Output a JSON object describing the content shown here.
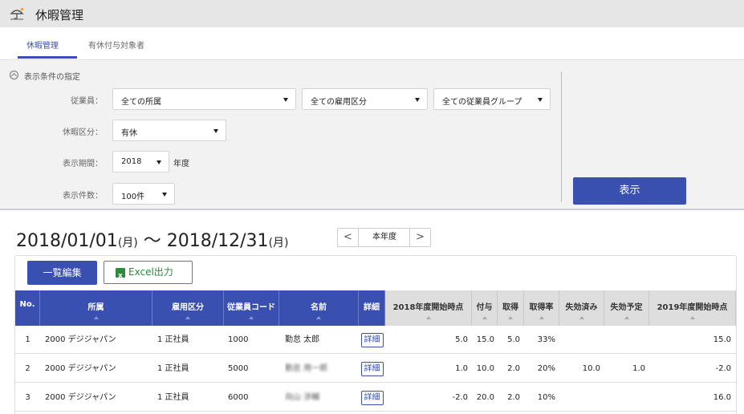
{
  "app": {
    "title": "休暇管理",
    "logo_icon": "umbrella-sun-icon"
  },
  "tabs": [
    {
      "label": "休暇管理",
      "active": true
    },
    {
      "label": "有休付与対象者",
      "active": false
    }
  ],
  "filter": {
    "header": "表示条件の指定",
    "employee_label": "従業員：",
    "department": "全ての所属",
    "employment_type": "全ての雇用区分",
    "employee_group": "全ての従業員グループ",
    "leave_type_label": "休暇区分：",
    "leave_type": "有休",
    "period_label": "表示期間：",
    "year": "2018",
    "year_unit": "年度",
    "count_label": "表示件数：",
    "count": "100件",
    "show_button": "表示"
  },
  "range": {
    "start": "2018/01/01",
    "start_dow": "(月)",
    "sep": " ～ ",
    "end": "2018/12/31",
    "end_dow": "(月)",
    "prev": "<",
    "current": "本年度",
    "next": ">"
  },
  "toolbar": {
    "edit_button": "一覧編集",
    "excel_button": "Excel出力"
  },
  "table": {
    "headers": [
      "No.",
      "所属",
      "雇用区分",
      "従業員コード",
      "名前",
      "詳細",
      "2018年度開始時点",
      "付与",
      "取得",
      "取得率",
      "失効済み",
      "失効予定",
      "2019年度開始時点"
    ],
    "rows": [
      {
        "no": "1",
        "dept": "2000 デジジャパン",
        "type": "1 正社員",
        "code": "1000",
        "name": "勤怠 太郎",
        "detail": "詳細",
        "start": "5.0",
        "grant": "15.0",
        "taken": "5.0",
        "rate": "33%",
        "expired": "",
        "expiring": "",
        "next": "15.0"
      },
      {
        "no": "2",
        "dept": "2000 デジジャパン",
        "type": "1 正社員",
        "code": "5000",
        "name": "勤怠 用一郎",
        "detail": "詳細",
        "start": "1.0",
        "grant": "10.0",
        "taken": "2.0",
        "rate": "20%",
        "expired": "10.0",
        "expiring": "1.0",
        "next": "-2.0"
      },
      {
        "no": "3",
        "dept": "2000 デジジャパン",
        "type": "1 正社員",
        "code": "6000",
        "name": "向山 渉輔",
        "detail": "詳細",
        "start": "-2.0",
        "grant": "20.0",
        "taken": "2.0",
        "rate": "10%",
        "expired": "",
        "expiring": "",
        "next": "16.0"
      }
    ]
  },
  "colors": {
    "accent": "#3a50b1",
    "excel": "#2e8a3c",
    "header_grey": "#dedede"
  }
}
